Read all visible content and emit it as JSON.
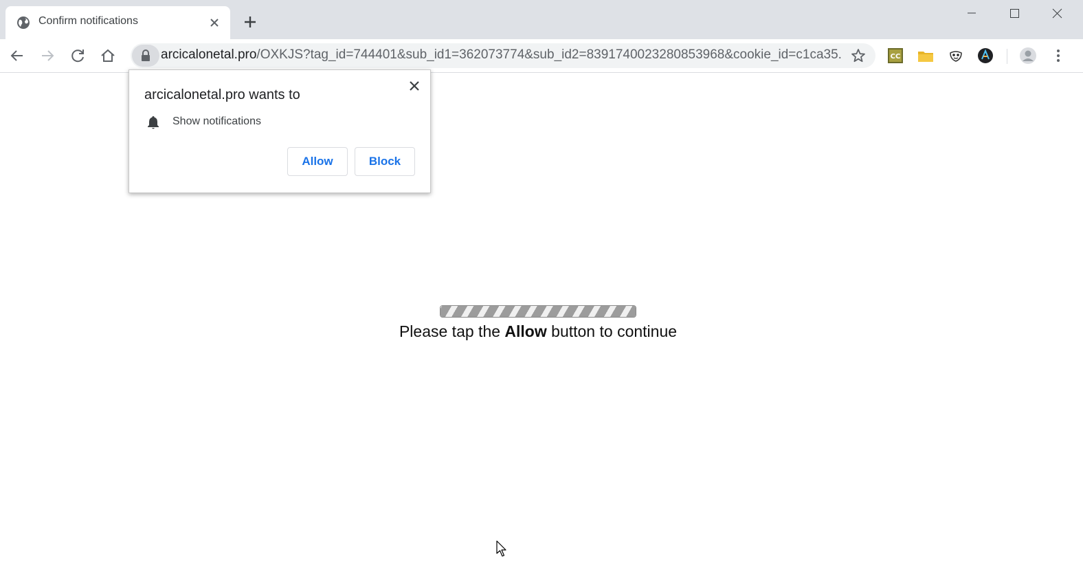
{
  "tab": {
    "title": "Confirm notifications"
  },
  "omnibox": {
    "host": "arcicalonetal.pro",
    "path": "/OXKJS?tag_id=744401&sub_id1=362073774&sub_id2=8391740023280853968&cookie_id=c1ca35..."
  },
  "popup": {
    "title": "arcicalonetal.pro wants to",
    "permission": "Show notifications",
    "allow_label": "Allow",
    "block_label": "Block"
  },
  "page": {
    "message_before": "Please tap the ",
    "message_bold": "Allow",
    "message_after": " button to continue",
    "progress": 1.0
  },
  "icons": {
    "tab": [
      "globe-icon",
      "close-icon",
      "plus-icon"
    ],
    "window": [
      "minimize-icon",
      "maximize-icon",
      "window-close-icon"
    ],
    "nav": [
      "back-arrow-icon",
      "forward-arrow-icon",
      "reload-icon",
      "home-icon"
    ],
    "omnibox": [
      "lock-icon",
      "star-icon"
    ],
    "extensions": [
      "cc-extension-icon",
      "folder-extension-icon",
      "mask-extension-icon",
      "a-extension-icon"
    ],
    "right": [
      "profile-avatar-icon",
      "kebab-menu-icon"
    ],
    "popup": [
      "bell-icon",
      "close-icon"
    ]
  },
  "colors": {
    "tabstrip_bg": "#dee1e6",
    "omnibox_bg": "#f1f3f4",
    "button_text": "#1a73e8"
  }
}
